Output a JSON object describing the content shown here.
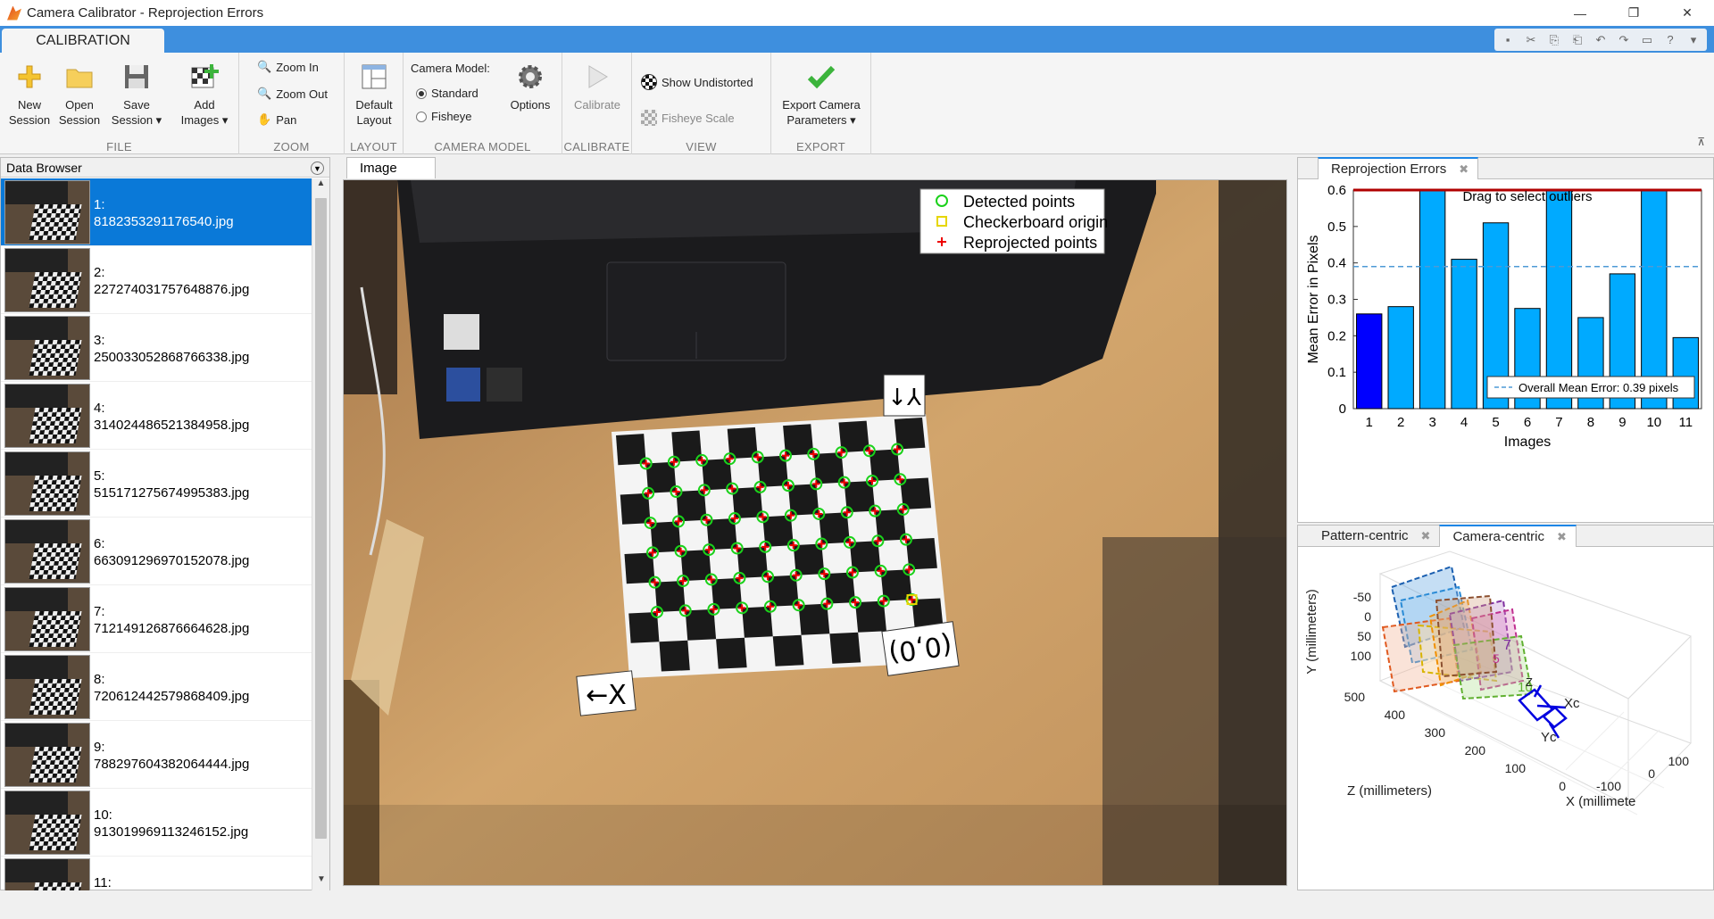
{
  "window": {
    "title": "Camera Calibrator - Reprojection Errors"
  },
  "ribbon": {
    "tab": "CALIBRATION",
    "sections": {
      "file": "FILE",
      "zoom": "ZOOM",
      "layout": "LAYOUT",
      "camera_model": "CAMERA MODEL",
      "calibrate": "CALIBRATE",
      "view": "VIEW",
      "export": "EXPORT"
    },
    "new_session": "New\nSession",
    "open_session": "Open\nSession",
    "save_session": "Save\nSession ▾",
    "add_images": "Add\nImages ▾",
    "zoom_in": "Zoom In",
    "zoom_out": "Zoom Out",
    "pan": "Pan",
    "default_layout": "Default\nLayout",
    "camera_model_label": "Camera Model:",
    "standard": "Standard",
    "fisheye": "Fisheye",
    "options": "Options",
    "calibrate": "Calibrate",
    "show_undistorted": "Show Undistorted",
    "fisheye_scale": "Fisheye Scale",
    "export": "Export Camera\nParameters ▾"
  },
  "browser": {
    "title": "Data Browser",
    "items": [
      {
        "label": "1:\n8182353291176540.jpg"
      },
      {
        "label": "2:\n227274031757648876.jpg"
      },
      {
        "label": "3:\n250033052868766338.jpg"
      },
      {
        "label": "4:\n314024486521384958.jpg"
      },
      {
        "label": "5:\n515171275674995383.jpg"
      },
      {
        "label": "6:\n663091296970152078.jpg"
      },
      {
        "label": "7:\n712149126876664628.jpg"
      },
      {
        "label": "8:\n720612442579868409.jpg"
      },
      {
        "label": "9:\n788297604382064444.jpg"
      },
      {
        "label": "10:\n913019969113246152.jpg"
      },
      {
        "label": "11:"
      }
    ]
  },
  "image_panel": {
    "tab": "Image",
    "legend": {
      "detected": "Detected points",
      "origin": "Checkerboard origin",
      "reprojected": "Reprojected points"
    },
    "labels": {
      "y": "Y↑",
      "origin": "(0,0)",
      "x": "←X"
    }
  },
  "reprojection": {
    "tab": "Reprojection Errors",
    "drag_hint": "Drag to select outliers",
    "mean_legend": "Overall Mean Error: 0.39 pixels",
    "chart_data": {
      "type": "bar",
      "categories": [
        "1",
        "2",
        "3",
        "4",
        "5",
        "6",
        "7",
        "8",
        "9",
        "10",
        "11"
      ],
      "values": [
        0.26,
        0.28,
        0.6,
        0.41,
        0.51,
        0.275,
        0.6,
        0.25,
        0.37,
        0.6,
        0.195
      ],
      "selected_index": 0,
      "mean": 0.39,
      "threshold": 0.6,
      "ylim": [
        0,
        0.6
      ],
      "yticks": [
        "0",
        "0.1",
        "0.2",
        "0.3",
        "0.4",
        "0.5",
        "0.6"
      ],
      "xlabel": "Images",
      "ylabel": "Mean Error in Pixels",
      "colors": {
        "bar": "#00aaff",
        "selected": "#0000ff",
        "mean": "#4d9ad6",
        "threshold": "#b00000"
      }
    }
  },
  "extrinsics": {
    "tabs": [
      "Pattern-centric",
      "Camera-centric"
    ],
    "active": 1,
    "y_label": "Y (millimeters)",
    "z_label": "Z (millimeters)",
    "x_label": "X (millimete",
    "y_ticks": [
      "-50",
      "0",
      "50",
      "100"
    ],
    "z_ticks": [
      "500",
      "400",
      "300",
      "200",
      "100",
      "0"
    ],
    "x_ticks": [
      "100",
      "0",
      "-100"
    ],
    "plane_labels": [
      "7",
      "5",
      "10"
    ],
    "axis_labels": {
      "xc": "Xc",
      "yc": "Yc",
      "z": "Z"
    }
  }
}
